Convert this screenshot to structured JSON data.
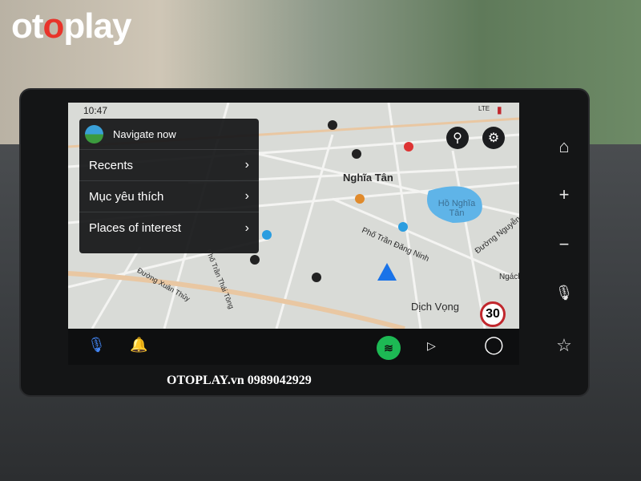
{
  "watermark": {
    "logo": "otoplay",
    "footer": "OTOPLAY.vn 0989042929"
  },
  "status_bar": {
    "time": "10:47",
    "network": "LTE"
  },
  "menu": {
    "navigate_now": "Navigate now",
    "items": [
      {
        "label": "Recents"
      },
      {
        "label": "Mục yêu thích"
      },
      {
        "label": "Places of interest"
      }
    ]
  },
  "map": {
    "labels": {
      "area1": "Nghĩa Tân",
      "lake": "Hồ Nghĩa Tân",
      "street1": "Phố Trần Đăng Ninh",
      "street2": "Đường Nguyễn",
      "street3": "Ngách",
      "area2": "Dịch Vọng",
      "street4": "Đường Xuân Thủy",
      "street5": "Phố Trần Thái Tông"
    },
    "speed_limit": "30"
  },
  "bottom_bar": {
    "icons": [
      "mic-icon",
      "bell-icon",
      "spotify-icon",
      "play-icon",
      "home-circle-icon"
    ]
  },
  "colors": {
    "accent": "#1a73e8",
    "spotify": "#1db954",
    "speed": "#c1272d"
  }
}
